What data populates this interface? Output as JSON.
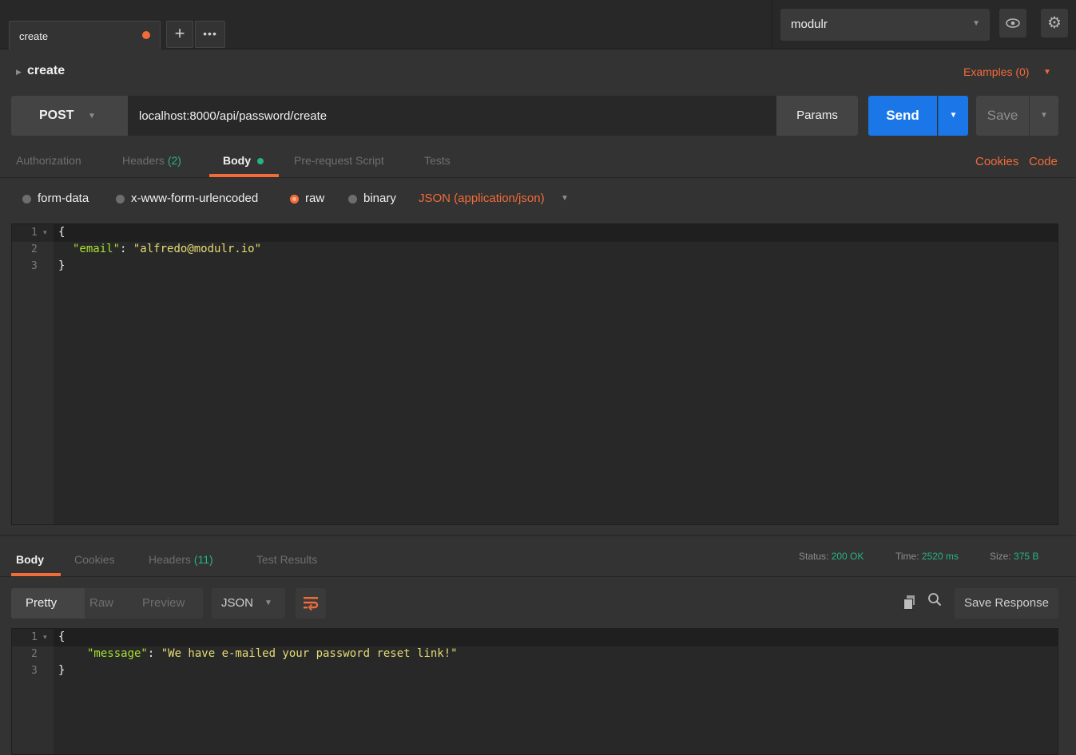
{
  "tab": {
    "label": "create",
    "new_tab": "+",
    "more": "•••"
  },
  "env": {
    "selected": "modulr",
    "caret": "▼",
    "eye_icon": "eye-icon",
    "gear_icon": "gear-icon"
  },
  "request": {
    "name": "create",
    "examples": "Examples (0)",
    "method": "POST",
    "url": "localhost:8000/api/password/create",
    "params": "Params",
    "send": "Send",
    "save": "Save"
  },
  "subtabs": {
    "authorization": "Authorization",
    "headers": "Headers",
    "headers_count": "(2)",
    "body": "Body",
    "prerequest": "Pre-request Script",
    "tests": "Tests",
    "cookies": "Cookies",
    "code": "Code"
  },
  "body_types": {
    "form_data": "form-data",
    "urlencoded": "x-www-form-urlencoded",
    "raw": "raw",
    "binary": "binary",
    "content_type": "JSON (application/json)",
    "selected": "raw"
  },
  "request_body": {
    "line_numbers": [
      "1",
      "2",
      "3"
    ],
    "open": "{",
    "key": "\"email\"",
    "sep": ": ",
    "value": "\"alfredo@modulr.io\"",
    "close": "}"
  },
  "response_tabs": {
    "body": "Body",
    "cookies": "Cookies",
    "headers": "Headers",
    "headers_count": "(11)",
    "test_results": "Test Results"
  },
  "response_meta": {
    "status_label": "Status:",
    "status_value": "200 OK",
    "time_label": "Time:",
    "time_value": "2520 ms",
    "size_label": "Size:",
    "size_value": "375 B"
  },
  "response_toolbar": {
    "pretty": "Pretty",
    "raw": "Raw",
    "preview": "Preview",
    "format": "JSON",
    "save_response": "Save Response"
  },
  "response_body": {
    "line_numbers": [
      "1",
      "2",
      "3"
    ],
    "open": "{",
    "key": "\"message\"",
    "sep": ": ",
    "value": "\"We have e-mailed your password reset link!\"",
    "close": "}"
  },
  "colors": {
    "accent": "#f26b3a",
    "send": "#1b77e8",
    "success": "#26b47f"
  }
}
